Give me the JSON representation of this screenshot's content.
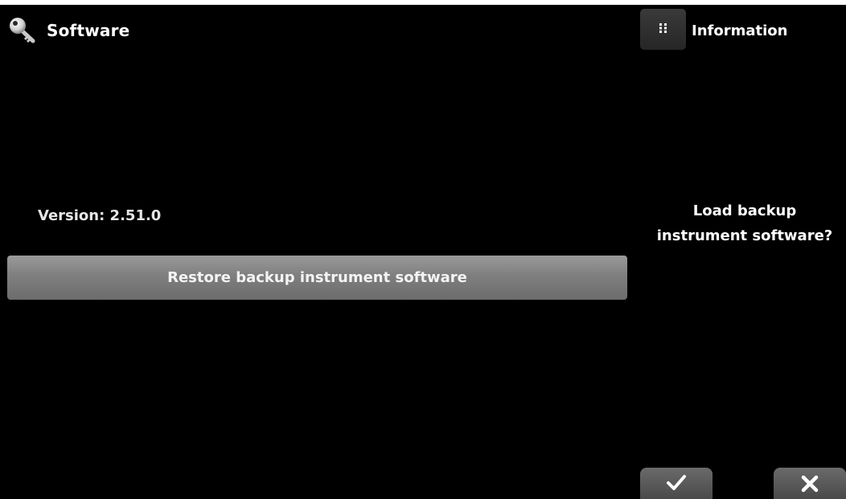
{
  "header": {
    "title": "Software",
    "icon": "key-icon"
  },
  "main": {
    "version_text": "Version: 2.51.0",
    "restore_button_label": "Restore backup instrument software"
  },
  "side_panel": {
    "info_button_icon": "grid-icon",
    "info_label": "Information",
    "prompt_line1": "Load backup",
    "prompt_line2": "instrument software?",
    "confirm_icon": "checkmark-icon",
    "cancel_icon": "close-icon"
  },
  "colors": {
    "background": "#000000",
    "button_gray": "#808080",
    "text": "#ffffff"
  }
}
